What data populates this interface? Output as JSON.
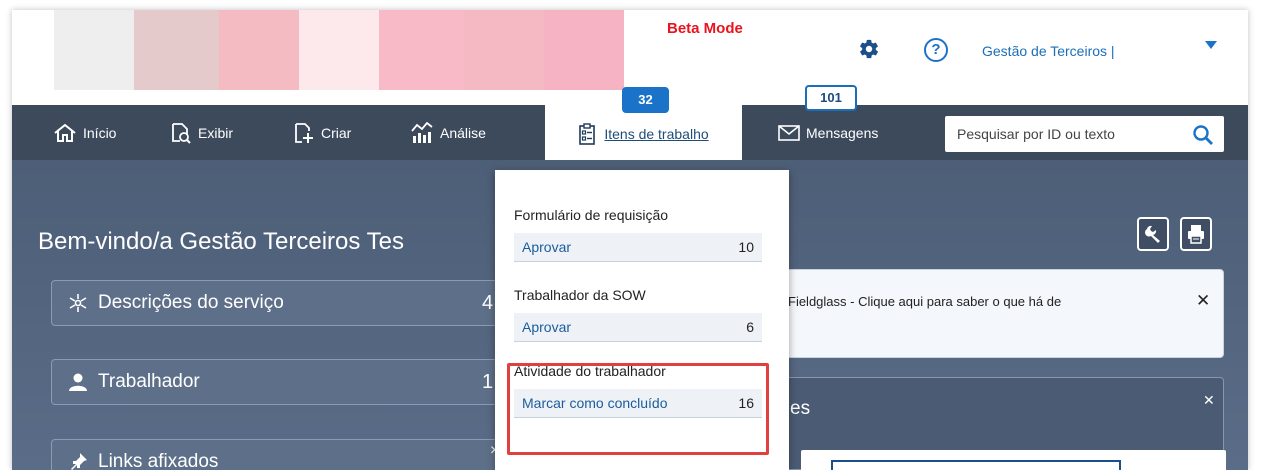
{
  "header": {
    "beta_label": "Beta Mode",
    "tenant_label": "Gestão de Terceiros |",
    "help_glyph": "?",
    "swatches": [
      "#eeeeee",
      "#e5cacc",
      "#f4bcc2",
      "#fde9ec",
      "#f7bac6",
      "#f4b9c3",
      "#f6b3c3"
    ]
  },
  "nav": {
    "items": [
      {
        "label": "Início",
        "icon": "home-icon"
      },
      {
        "label": "Exibir",
        "icon": "view-icon"
      },
      {
        "label": "Criar",
        "icon": "create-icon"
      },
      {
        "label": "Análise",
        "icon": "analytics-icon"
      },
      {
        "label": "Itens de trabalho",
        "icon": "clipboard-icon"
      },
      {
        "label": "Mensagens",
        "icon": "envelope-icon"
      }
    ],
    "work_items_count": "32",
    "messages_count": "101",
    "search_placeholder": "Pesquisar por ID ou texto"
  },
  "main": {
    "welcome": "Bem-vindo/a Gestão Terceiros Tes",
    "panels": [
      {
        "label": "Descrições do serviço",
        "count": "4"
      },
      {
        "label": "Trabalhador",
        "count": "1"
      },
      {
        "label": "Links afixados",
        "close": "×"
      }
    ],
    "notice_text": "Fieldglass - Clique aqui para saber o que há de",
    "notice_close": "✕",
    "card_title": "es",
    "card_close": "✕"
  },
  "dropdown": {
    "groups": [
      {
        "title": "Formulário de requisição",
        "row_label": "Aprovar",
        "row_count": "10"
      },
      {
        "title": "Trabalhador da SOW",
        "row_label": "Aprovar",
        "row_count": "6"
      },
      {
        "title": "Atividade do trabalhador",
        "row_label": "Marcar como concluído",
        "row_count": "16"
      }
    ]
  },
  "colors": {
    "nav_bg": "#3c4a5c",
    "accent": "#1a73c8",
    "beta_red": "#e8141e",
    "highlight": "#e0413e"
  }
}
